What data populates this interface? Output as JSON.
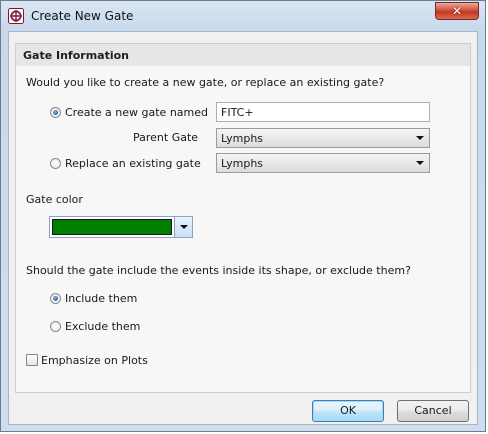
{
  "window": {
    "title": "Create New Gate",
    "close_symbol": "✕"
  },
  "group": {
    "title": "Gate Information"
  },
  "question_gate": "Would you like to create a new gate, or replace an existing gate?",
  "option_new": {
    "label": "Create a new gate named",
    "selected": true,
    "name_value": "FITC+"
  },
  "parent_gate": {
    "label": "Parent Gate",
    "value": "Lymphs"
  },
  "option_replace": {
    "label": "Replace an existing gate",
    "selected": false,
    "value": "Lymphs"
  },
  "gate_color": {
    "label": "Gate color",
    "color": "#008000"
  },
  "question_events": "Should the gate include the events inside its shape, or exclude them?",
  "option_include": {
    "label": "Include them",
    "selected": true
  },
  "option_exclude": {
    "label": "Exclude them",
    "selected": false
  },
  "emphasize": {
    "label": "Emphasize on Plots",
    "checked": false
  },
  "buttons": {
    "ok": "OK",
    "cancel": "Cancel"
  },
  "colors": {
    "accent_radio": "#1c4f8a",
    "default_button_border": "#3c7fb1"
  }
}
